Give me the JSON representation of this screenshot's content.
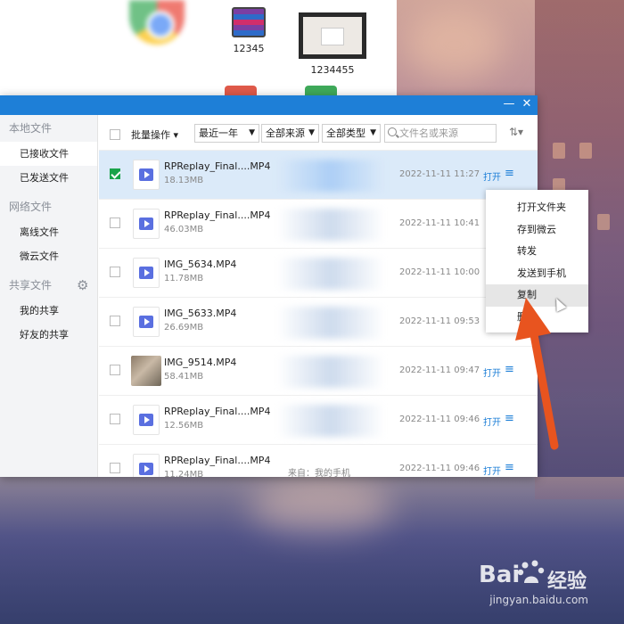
{
  "desktop": {
    "items": [
      {
        "label": "12345"
      },
      {
        "label": "1234455"
      }
    ]
  },
  "window": {
    "controls": {
      "minimize": "—",
      "close": "✕"
    },
    "sidebar": {
      "sections": [
        {
          "title": "本地文件",
          "items": [
            {
              "label": "已接收文件",
              "active": true
            },
            {
              "label": "已发送文件"
            }
          ]
        },
        {
          "title": "网络文件",
          "items": [
            {
              "label": "离线文件"
            },
            {
              "label": "微云文件"
            }
          ]
        },
        {
          "title": "共享文件",
          "items": [
            {
              "label": "我的共享"
            },
            {
              "label": "好友的共享"
            }
          ]
        }
      ]
    },
    "toolbar": {
      "batch_label": "批量操作",
      "time_filter": "最近一年",
      "source_filter": "全部来源",
      "type_filter": "全部类型",
      "search_placeholder": "文件名或来源"
    },
    "files": [
      {
        "name": "RPReplay_Final....MP4",
        "size": "18.13MB",
        "date": "2022-11-11 11:27",
        "open": "打开",
        "selected": true
      },
      {
        "name": "RPReplay_Final....MP4",
        "size": "46.03MB",
        "date": "2022-11-11 10:41"
      },
      {
        "name": "IMG_5634.MP4",
        "size": "11.78MB",
        "date": "2022-11-11 10:00"
      },
      {
        "name": "IMG_5633.MP4",
        "size": "26.69MB",
        "date": "2022-11-11 09:53"
      },
      {
        "name": "IMG_9514.MP4",
        "size": "58.41MB",
        "date": "2022-11-11 09:47",
        "open": "打开"
      },
      {
        "name": "RPReplay_Final....MP4",
        "size": "12.56MB",
        "date": "2022-11-11 09:46",
        "open": "打开"
      },
      {
        "name": "RPReplay_Final....MP4",
        "size": "11.24MB",
        "date": "2022-11-11 09:46",
        "open": "打开",
        "source": "来自：我的手机"
      }
    ]
  },
  "context_menu": {
    "items": [
      "打开文件夹",
      "存到微云",
      "转发",
      "发送到手机",
      "复制",
      "删"
    ]
  },
  "watermark": {
    "brand": "Bai",
    "brand2": "经验",
    "url": "jingyan.baidu.com"
  }
}
